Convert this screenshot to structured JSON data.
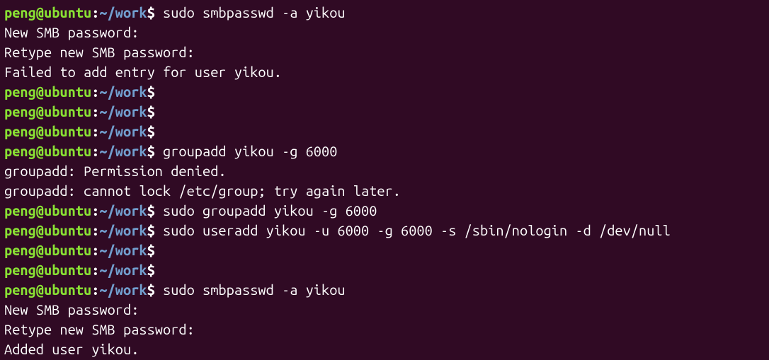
{
  "prompt": {
    "user_host": "peng@ubuntu",
    "separator": ":",
    "path": "~/work",
    "symbol": "$"
  },
  "lines": [
    {
      "type": "prompt",
      "command": "sudo smbpasswd -a yikou"
    },
    {
      "type": "output",
      "text": "New SMB password:"
    },
    {
      "type": "output",
      "text": "Retype new SMB password:"
    },
    {
      "type": "output",
      "text": "Failed to add entry for user yikou."
    },
    {
      "type": "prompt",
      "command": ""
    },
    {
      "type": "prompt",
      "command": ""
    },
    {
      "type": "prompt",
      "command": ""
    },
    {
      "type": "prompt",
      "command": "groupadd yikou -g 6000"
    },
    {
      "type": "output",
      "text": "groupadd: Permission denied."
    },
    {
      "type": "output",
      "text": "groupadd: cannot lock /etc/group; try again later."
    },
    {
      "type": "prompt",
      "command": "sudo groupadd yikou -g 6000"
    },
    {
      "type": "prompt",
      "command": "sudo useradd yikou -u 6000 -g 6000 -s /sbin/nologin -d /dev/null"
    },
    {
      "type": "prompt",
      "command": ""
    },
    {
      "type": "prompt",
      "command": ""
    },
    {
      "type": "prompt",
      "command": "sudo smbpasswd -a yikou"
    },
    {
      "type": "output",
      "text": "New SMB password:"
    },
    {
      "type": "output",
      "text": "Retype new SMB password:"
    },
    {
      "type": "output",
      "text": "Added user yikou."
    }
  ]
}
